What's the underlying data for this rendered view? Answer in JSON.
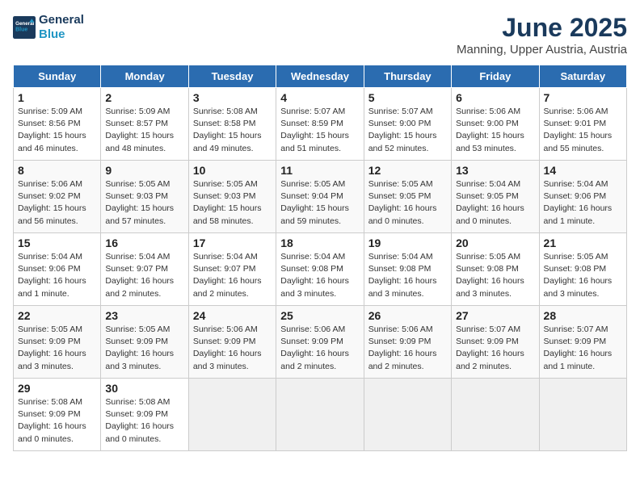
{
  "logo": {
    "line1": "General",
    "line2": "Blue"
  },
  "title": "June 2025",
  "subtitle": "Manning, Upper Austria, Austria",
  "weekdays": [
    "Sunday",
    "Monday",
    "Tuesday",
    "Wednesday",
    "Thursday",
    "Friday",
    "Saturday"
  ],
  "weeks": [
    [
      {
        "day": "1",
        "info": "Sunrise: 5:09 AM\nSunset: 8:56 PM\nDaylight: 15 hours\nand 46 minutes."
      },
      {
        "day": "2",
        "info": "Sunrise: 5:09 AM\nSunset: 8:57 PM\nDaylight: 15 hours\nand 48 minutes."
      },
      {
        "day": "3",
        "info": "Sunrise: 5:08 AM\nSunset: 8:58 PM\nDaylight: 15 hours\nand 49 minutes."
      },
      {
        "day": "4",
        "info": "Sunrise: 5:07 AM\nSunset: 8:59 PM\nDaylight: 15 hours\nand 51 minutes."
      },
      {
        "day": "5",
        "info": "Sunrise: 5:07 AM\nSunset: 9:00 PM\nDaylight: 15 hours\nand 52 minutes."
      },
      {
        "day": "6",
        "info": "Sunrise: 5:06 AM\nSunset: 9:00 PM\nDaylight: 15 hours\nand 53 minutes."
      },
      {
        "day": "7",
        "info": "Sunrise: 5:06 AM\nSunset: 9:01 PM\nDaylight: 15 hours\nand 55 minutes."
      }
    ],
    [
      {
        "day": "8",
        "info": "Sunrise: 5:06 AM\nSunset: 9:02 PM\nDaylight: 15 hours\nand 56 minutes."
      },
      {
        "day": "9",
        "info": "Sunrise: 5:05 AM\nSunset: 9:03 PM\nDaylight: 15 hours\nand 57 minutes."
      },
      {
        "day": "10",
        "info": "Sunrise: 5:05 AM\nSunset: 9:03 PM\nDaylight: 15 hours\nand 58 minutes."
      },
      {
        "day": "11",
        "info": "Sunrise: 5:05 AM\nSunset: 9:04 PM\nDaylight: 15 hours\nand 59 minutes."
      },
      {
        "day": "12",
        "info": "Sunrise: 5:05 AM\nSunset: 9:05 PM\nDaylight: 16 hours\nand 0 minutes."
      },
      {
        "day": "13",
        "info": "Sunrise: 5:04 AM\nSunset: 9:05 PM\nDaylight: 16 hours\nand 0 minutes."
      },
      {
        "day": "14",
        "info": "Sunrise: 5:04 AM\nSunset: 9:06 PM\nDaylight: 16 hours\nand 1 minute."
      }
    ],
    [
      {
        "day": "15",
        "info": "Sunrise: 5:04 AM\nSunset: 9:06 PM\nDaylight: 16 hours\nand 1 minute."
      },
      {
        "day": "16",
        "info": "Sunrise: 5:04 AM\nSunset: 9:07 PM\nDaylight: 16 hours\nand 2 minutes."
      },
      {
        "day": "17",
        "info": "Sunrise: 5:04 AM\nSunset: 9:07 PM\nDaylight: 16 hours\nand 2 minutes."
      },
      {
        "day": "18",
        "info": "Sunrise: 5:04 AM\nSunset: 9:08 PM\nDaylight: 16 hours\nand 3 minutes."
      },
      {
        "day": "19",
        "info": "Sunrise: 5:04 AM\nSunset: 9:08 PM\nDaylight: 16 hours\nand 3 minutes."
      },
      {
        "day": "20",
        "info": "Sunrise: 5:05 AM\nSunset: 9:08 PM\nDaylight: 16 hours\nand 3 minutes."
      },
      {
        "day": "21",
        "info": "Sunrise: 5:05 AM\nSunset: 9:08 PM\nDaylight: 16 hours\nand 3 minutes."
      }
    ],
    [
      {
        "day": "22",
        "info": "Sunrise: 5:05 AM\nSunset: 9:09 PM\nDaylight: 16 hours\nand 3 minutes."
      },
      {
        "day": "23",
        "info": "Sunrise: 5:05 AM\nSunset: 9:09 PM\nDaylight: 16 hours\nand 3 minutes."
      },
      {
        "day": "24",
        "info": "Sunrise: 5:06 AM\nSunset: 9:09 PM\nDaylight: 16 hours\nand 3 minutes."
      },
      {
        "day": "25",
        "info": "Sunrise: 5:06 AM\nSunset: 9:09 PM\nDaylight: 16 hours\nand 2 minutes."
      },
      {
        "day": "26",
        "info": "Sunrise: 5:06 AM\nSunset: 9:09 PM\nDaylight: 16 hours\nand 2 minutes."
      },
      {
        "day": "27",
        "info": "Sunrise: 5:07 AM\nSunset: 9:09 PM\nDaylight: 16 hours\nand 2 minutes."
      },
      {
        "day": "28",
        "info": "Sunrise: 5:07 AM\nSunset: 9:09 PM\nDaylight: 16 hours\nand 1 minute."
      }
    ],
    [
      {
        "day": "29",
        "info": "Sunrise: 5:08 AM\nSunset: 9:09 PM\nDaylight: 16 hours\nand 0 minutes."
      },
      {
        "day": "30",
        "info": "Sunrise: 5:08 AM\nSunset: 9:09 PM\nDaylight: 16 hours\nand 0 minutes."
      },
      {
        "day": "",
        "info": ""
      },
      {
        "day": "",
        "info": ""
      },
      {
        "day": "",
        "info": ""
      },
      {
        "day": "",
        "info": ""
      },
      {
        "day": "",
        "info": ""
      }
    ]
  ]
}
